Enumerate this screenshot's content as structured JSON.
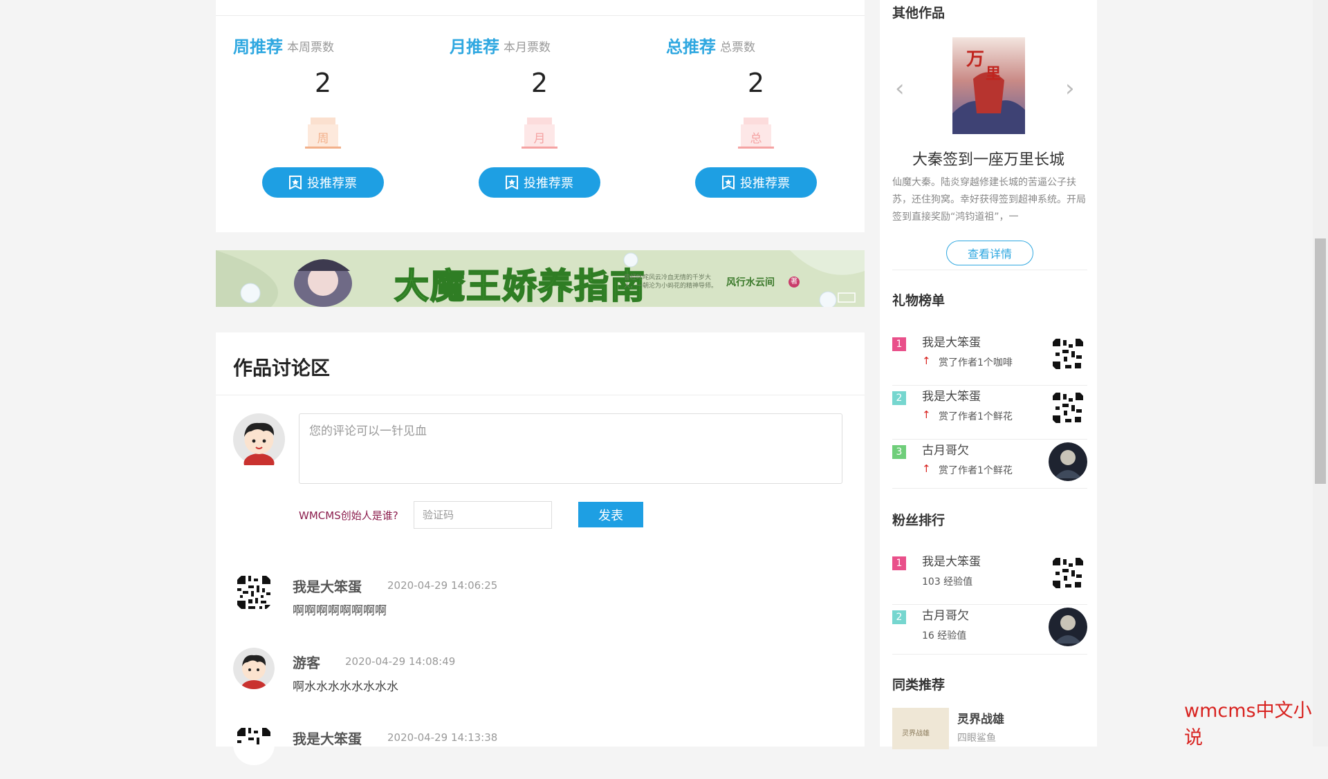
{
  "recommend": {
    "columns": [
      {
        "title": "周推荐",
        "sub": "本周票数",
        "count": "2",
        "badge_char": "周",
        "badge_color": "#f2b08a",
        "vote_label": "投推荐票"
      },
      {
        "title": "月推荐",
        "sub": "本月票数",
        "count": "2",
        "badge_char": "月",
        "badge_color": "#f5a3a3",
        "vote_label": "投推荐票"
      },
      {
        "title": "总推荐",
        "sub": "总票数",
        "count": "2",
        "badge_char": "总",
        "badge_color": "#f5a3a3",
        "vote_label": "投推荐票"
      }
    ]
  },
  "banner": {
    "title": "大魔王娇养指南",
    "tagline": "曾经叱咤风云冷血无情的千岁大人，一朝沦为小蚂花的精神导师。",
    "author": "风行水云间",
    "author_tag": "著"
  },
  "discussion": {
    "heading": "作品讨论区",
    "comment_placeholder": "您的评论可以一针见血",
    "captcha_question": "WMCMS创始人是谁?",
    "captcha_placeholder": "验证码",
    "post_label": "发表",
    "comments": [
      {
        "user": "我是大笨蛋",
        "time": "2020-04-29 14:06:25",
        "text": "啊啊啊啊啊啊啊啊",
        "avatar": "qr"
      },
      {
        "user": "游客",
        "time": "2020-04-29 14:08:49",
        "text": "啊水水水水水水水水",
        "avatar": "cartoon"
      },
      {
        "user": "我是大笨蛋",
        "time": "2020-04-29 14:13:38",
        "text": "",
        "avatar": "qr"
      }
    ]
  },
  "sidebar": {
    "other_works_title": "其他作品",
    "work": {
      "title": "大秦签到一座万里长城",
      "desc": "仙魔大秦。陆炎穿越修建长城的苦逼公子扶苏，还住狗窝。幸好获得签到超神系统。开局签到直接奖励“鸿钧道祖”，一",
      "detail_label": "查看详情"
    },
    "gift_title": "礼物榜单",
    "gifts": [
      {
        "rank": "1",
        "name": "我是大笨蛋",
        "desc": "赏了作者1个咖啡",
        "color": "#e9508a",
        "avatar": "qr"
      },
      {
        "rank": "2",
        "name": "我是大笨蛋",
        "desc": "赏了作者1个鲜花",
        "color": "#76d6cf",
        "avatar": "qr"
      },
      {
        "rank": "3",
        "name": "古月哥欠",
        "desc": "赏了作者1个鲜花",
        "color": "#6fce7a",
        "avatar": "dark"
      }
    ],
    "fans_title": "粉丝排行",
    "fans": [
      {
        "rank": "1",
        "name": "我是大笨蛋",
        "desc": "103 经验值",
        "color": "#e9508a",
        "avatar": "qr"
      },
      {
        "rank": "2",
        "name": "古月哥欠",
        "desc": "16 经验值",
        "color": "#76d6cf",
        "avatar": "dark"
      }
    ],
    "similar_title": "同类推荐",
    "similar": {
      "title": "灵界战雄",
      "author": "四眼鲨鱼",
      "cover_text": "灵界战雄"
    }
  },
  "watermark": "wmcms中文小说",
  "colors": {
    "accent": "#1e9fe3",
    "title_blue": "#2ea7e0",
    "captcha_red": "#8b1c4c",
    "watermark_red": "#d8221f"
  }
}
